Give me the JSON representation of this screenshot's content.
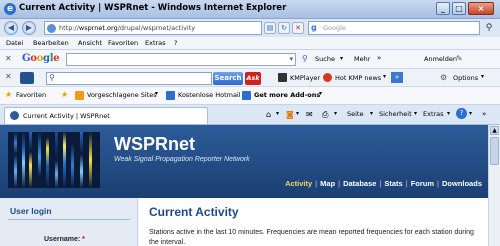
{
  "window": {
    "title": "Current Activity | WSPRnet - Windows Internet Explorer",
    "buttons": {
      "minimize": "_",
      "maximize": "□",
      "close": "×"
    }
  },
  "address_bar": {
    "url_prefix": "http://",
    "url_host": "wsprnet.org",
    "url_path": "/drupal/wsprnet/activity",
    "search_placeholder": "Google"
  },
  "menu": [
    "Datei",
    "Bearbeiten",
    "Ansicht",
    "Favoriten",
    "Extras",
    "?"
  ],
  "google_toolbar": {
    "logo": "Google",
    "search_label": "Suche",
    "more_label": "Mehr",
    "signin_label": "Anmelden"
  },
  "kmp_toolbar": {
    "search_button": "Search",
    "ask_label": "Ask",
    "kmplayer_label": "KMPlayer",
    "hot_news_label": "Hot KMP news",
    "options_label": "Options"
  },
  "favorites_bar": {
    "favorites_label": "Favoriten",
    "suggested_sites": "Vorgeschlagene Sites",
    "hotmail": "Kostenlose Hotmail",
    "addons": "Get more Add-ons"
  },
  "tab": {
    "label": "Current Activity | WSPRnet"
  },
  "command_bar": {
    "page": "Seite",
    "safety": "Sicherheit",
    "tools": "Extras"
  },
  "site": {
    "name": "WSPRnet",
    "slogan": "Weak Signal Propagation Reporter Network",
    "nav": [
      "Activity",
      "Map",
      "Database",
      "Stats",
      "Forum",
      "Downloads"
    ]
  },
  "login": {
    "title": "User login",
    "username_label": "Username:",
    "required_mark": "*"
  },
  "content": {
    "title": "Current Activity",
    "intro": "Stations active in the last 10 minutes. Frequencies are mean reported frequencies for each station during the interval."
  }
}
